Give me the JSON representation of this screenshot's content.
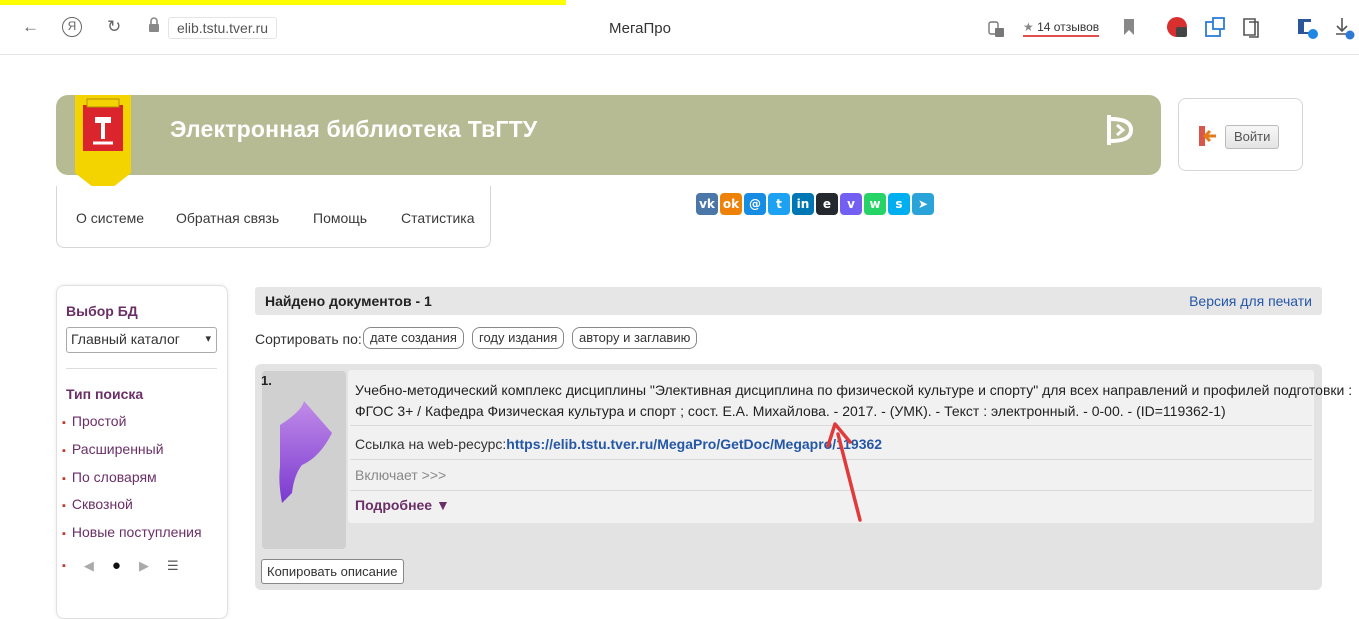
{
  "browser": {
    "address": "elib.tstu.tver.ru",
    "page_title": "МегаПро",
    "reviews": "14 отзывов",
    "reviews_star": "★",
    "back_icon": "←",
    "reload_icon": "↻",
    "yandex_icon": "Я",
    "lock_icon": "🔒"
  },
  "header": {
    "title": "Электронная библиотека ТвГТУ",
    "login_label": "Войти",
    "colors": {
      "banner": "#b6bb94",
      "accent": "#6b2f67",
      "link": "#2557a7"
    }
  },
  "nav": {
    "items": [
      "О системе",
      "Обратная связь",
      "Помощь",
      "Статистика"
    ]
  },
  "social": [
    {
      "icon": "vk-icon",
      "glyph": "vk",
      "color": "#4a76a8"
    },
    {
      "icon": "odnoklassniki-icon",
      "glyph": "ok",
      "color": "#ee8208"
    },
    {
      "icon": "moimir-icon",
      "glyph": "@",
      "color": "#168de2"
    },
    {
      "icon": "twitter-icon",
      "glyph": "t",
      "color": "#1da1f2"
    },
    {
      "icon": "linkedin-icon",
      "glyph": "in",
      "color": "#0077b5"
    },
    {
      "icon": "evernote-icon",
      "glyph": "e",
      "color": "#24292f"
    },
    {
      "icon": "viber-icon",
      "glyph": "v",
      "color": "#7360f2"
    },
    {
      "icon": "whatsapp-icon",
      "glyph": "w",
      "color": "#25d366"
    },
    {
      "icon": "skype-icon",
      "glyph": "s",
      "color": "#00aff0"
    },
    {
      "icon": "telegram-icon",
      "glyph": "➤",
      "color": "#2aa3d8"
    }
  ],
  "sidebar": {
    "db_heading": "Выбор БД",
    "db_selected": "Главный каталог",
    "search_heading": "Тип поиска",
    "search_types": [
      "Простой",
      "Расширенный",
      "По словарям",
      "Сквозной",
      "Новые поступления"
    ],
    "pager": {
      "bullet": "▪",
      "prev": "◀",
      "dot": "●",
      "next": "▶",
      "menu": "☰"
    }
  },
  "results": {
    "found": "Найдено документов - 1",
    "print_version": "Версия для печати",
    "sort_label": "Сортировать по:",
    "sort_options": [
      "дате создания",
      "году издания",
      "автору и заглавию"
    ],
    "items": [
      {
        "number": "1.",
        "description_line1": "Учебно-методический комплекс дисциплины \"Элективная дисциплина по физической культуре и спорту\" для всех направлений и профилей подготовки :",
        "description_line2": "ФГОС 3+ / Кафедра Физическая культура и спорт ; сост. Е.А. Михайлова. - 2017. - (УМК). - Текст : электронный. - 0-00. - (ID=119362-1)",
        "link_label": "Ссылка на web-ресурс:",
        "link_url": "https://elib.tstu.tver.ru/MegaPro/GetDoc/Megapro/119362",
        "includes": "Включает >>>",
        "more": "Подробнее ▼"
      }
    ],
    "copy_button": "Копировать описание"
  }
}
